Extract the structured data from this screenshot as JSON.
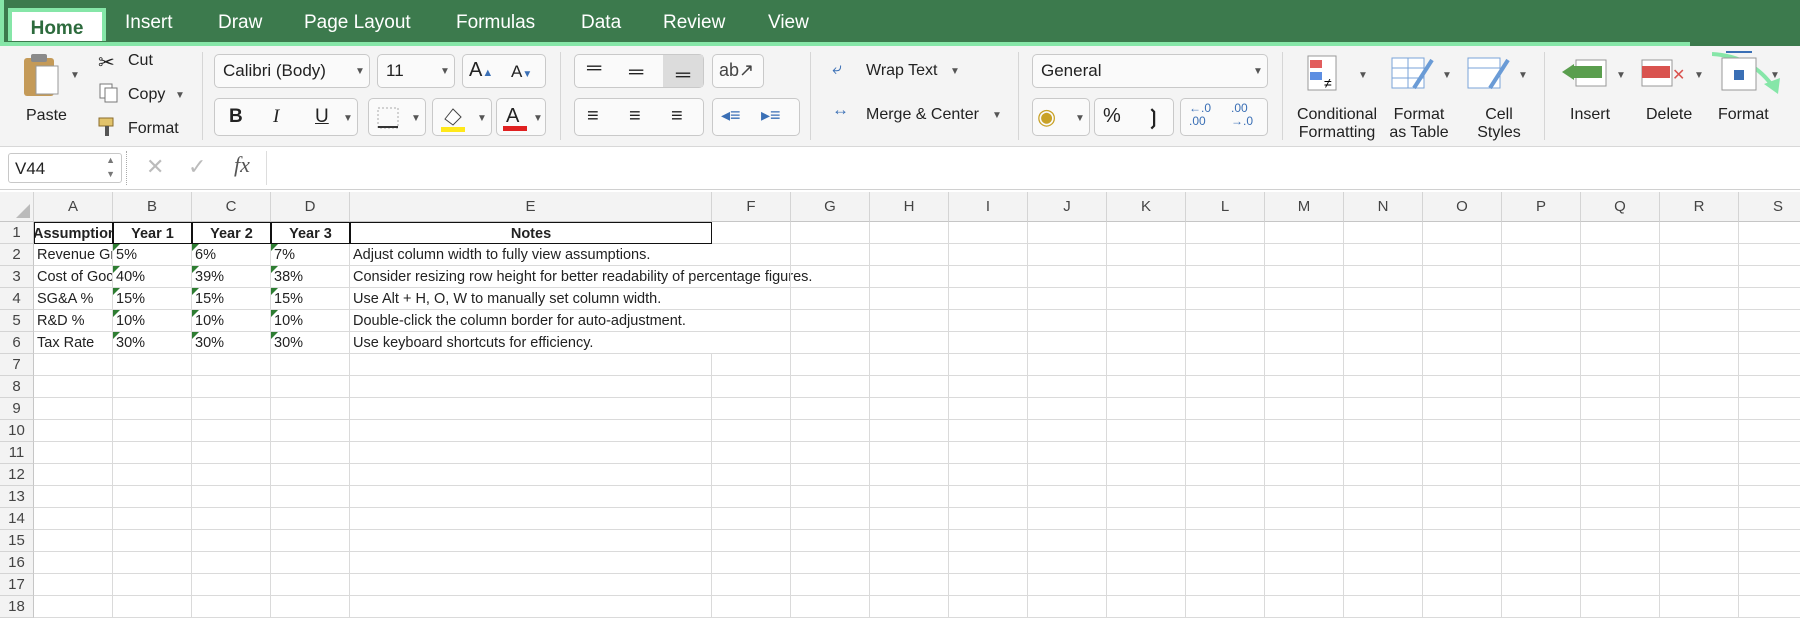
{
  "tabs": [
    "Home",
    "Insert",
    "Draw",
    "Page Layout",
    "Formulas",
    "Data",
    "Review",
    "View"
  ],
  "clipboard": {
    "paste": "Paste",
    "cut": "Cut",
    "copy": "Copy",
    "format": "Format"
  },
  "font": {
    "name": "Calibri (Body)",
    "size": "11"
  },
  "alignment": {
    "wrap": "Wrap Text",
    "merge": "Merge & Center"
  },
  "number": {
    "format": "General",
    "percent": "%"
  },
  "styles": {
    "conditional_1": "Conditional",
    "conditional_2": "Formatting",
    "table_1": "Format",
    "table_2": "as Table",
    "cell_1": "Cell",
    "cell_2": "Styles"
  },
  "cells_group": {
    "insert": "Insert",
    "delete": "Delete",
    "format": "Format"
  },
  "formula_bar": {
    "name_box": "V44",
    "fx": "fx"
  },
  "columns": [
    "A",
    "B",
    "C",
    "D",
    "E",
    "F",
    "G",
    "H",
    "I",
    "J",
    "K",
    "L",
    "M",
    "N",
    "O",
    "P",
    "Q",
    "R",
    "S"
  ],
  "rows": [
    "1",
    "2",
    "3",
    "4",
    "5",
    "6",
    "7",
    "8",
    "9",
    "10",
    "11",
    "12",
    "13",
    "14",
    "15",
    "16",
    "17",
    "18"
  ],
  "table": {
    "header": [
      "Assumption",
      "Year 1",
      "Year 2",
      "Year 3",
      "Notes"
    ],
    "rows": [
      [
        "Revenue Gr",
        "5%",
        "6%",
        "7%",
        "Adjust column width to fully view assumptions."
      ],
      [
        "Cost of Goc",
        "40%",
        "39%",
        "38%",
        "Consider resizing row height for better readability of percentage figures."
      ],
      [
        "SG&A %",
        "15%",
        "15%",
        "15%",
        "Use Alt + H, O, W to manually set column width."
      ],
      [
        "R&D %",
        "10%",
        "10%",
        "10%",
        "Double-click the column border for auto-adjustment."
      ],
      [
        "Tax Rate",
        "30%",
        "30%",
        "30%",
        "Use keyboard shortcuts for efficiency."
      ]
    ]
  },
  "colors": {
    "ribbon_green": "#3c7a4d",
    "highlight": "#86e6a8",
    "error_triangle": "#2e7d32"
  }
}
